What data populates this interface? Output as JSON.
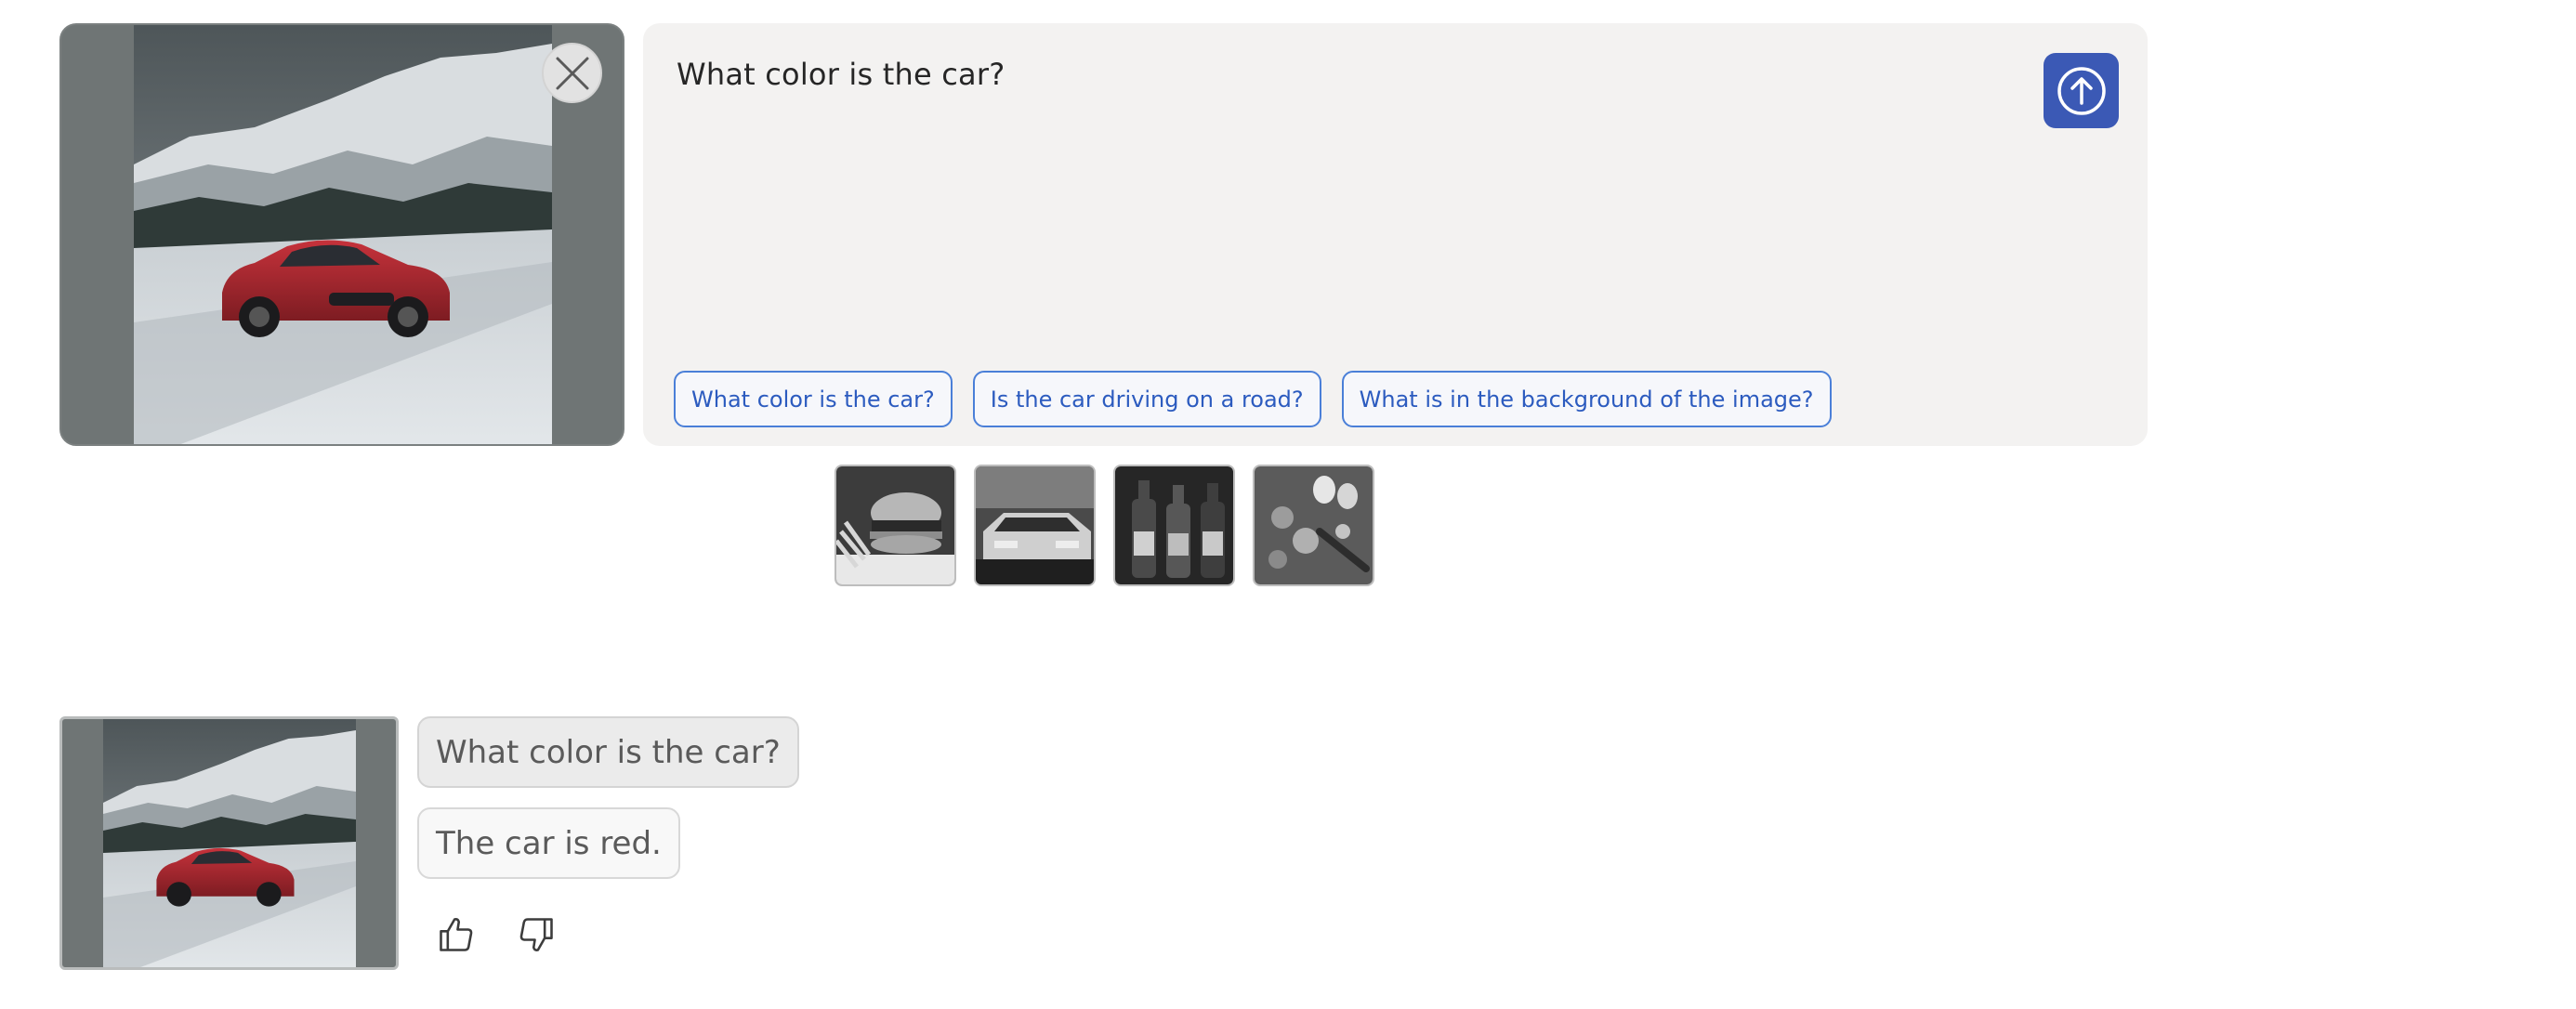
{
  "preview": {
    "image_alt": "Red sports car driving on a snowy mountain road",
    "close_icon": "close-icon"
  },
  "prompt": {
    "text": "What color is the car?",
    "send_icon": "arrow-up-circle-icon",
    "accent": "#3b59b5"
  },
  "suggestions": [
    "What color is the car?",
    "Is the car driving on a road?",
    "What is in the background of the image?"
  ],
  "samples": [
    {
      "name": "burger-fries"
    },
    {
      "name": "vintage-car"
    },
    {
      "name": "wine-bottles"
    },
    {
      "name": "kitchen-ingredients"
    }
  ],
  "conversation": {
    "question": "What color is the car?",
    "answer": "The car is red.",
    "like_icon": "thumbs-up-icon",
    "dislike_icon": "thumbs-down-icon"
  }
}
